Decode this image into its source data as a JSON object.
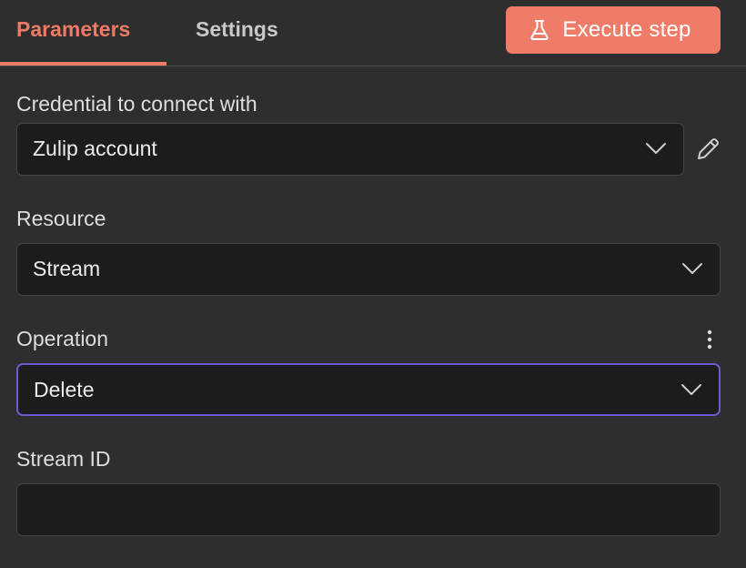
{
  "tabs": {
    "parameters_label": "Parameters",
    "settings_label": "Settings"
  },
  "header": {
    "execute_label": "Execute step"
  },
  "fields": {
    "credential": {
      "label": "Credential to connect with",
      "value": "Zulip account"
    },
    "resource": {
      "label": "Resource",
      "value": "Stream"
    },
    "operation": {
      "label": "Operation",
      "value": "Delete"
    },
    "stream_id": {
      "label": "Stream ID",
      "value": ""
    }
  },
  "icons": {
    "execute": "flask-icon",
    "edit_credential": "pencil-icon",
    "operation_options": "kebab-menu-icon",
    "dropdown": "chevron-down-icon"
  },
  "colors": {
    "accent": "#ec7b65",
    "button_bg": "#ef7c68",
    "focus_border": "#6d5bd0",
    "panel_bg": "#2e2e2e",
    "field_bg": "#1c1c1c"
  }
}
